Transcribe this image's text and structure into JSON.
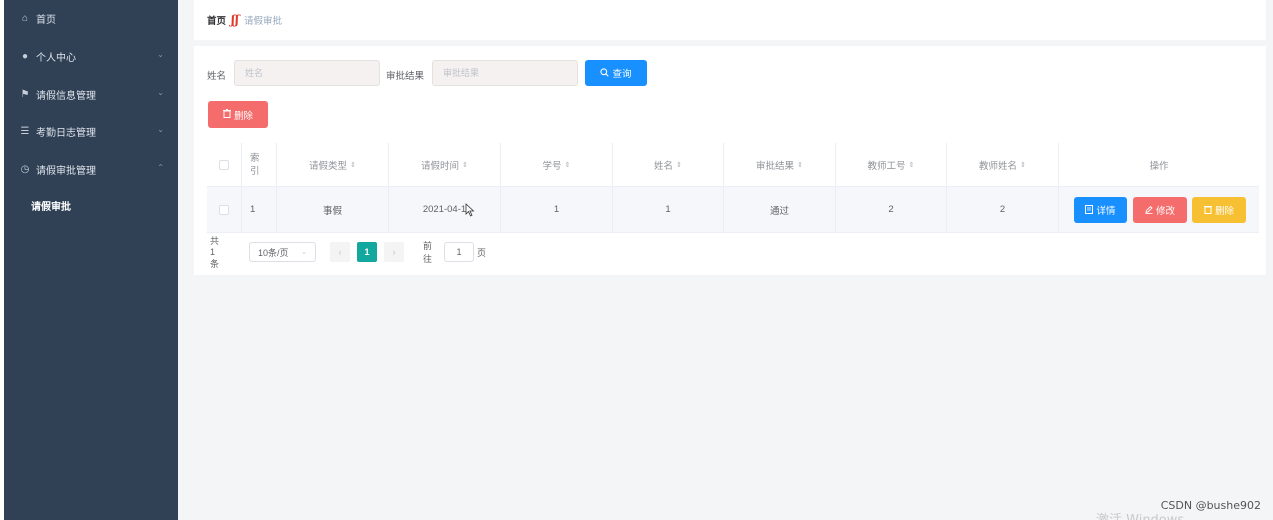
{
  "sidebar": {
    "items": [
      {
        "label": "首页",
        "icon": "home-icon",
        "glyph": "⌂"
      },
      {
        "label": "个人中心",
        "icon": "user-icon",
        "glyph": "●"
      },
      {
        "label": "请假信息管理",
        "icon": "flag-icon",
        "glyph": "⚑"
      },
      {
        "label": "考勤日志管理",
        "icon": "list-icon",
        "glyph": "☰"
      },
      {
        "label": "请假审批管理",
        "icon": "clock-icon",
        "glyph": "◷"
      }
    ],
    "submenu": {
      "label": "请假审批"
    },
    "chevron_down": "⌄",
    "chevron_up": "⌃",
    "bg_color": "#304156"
  },
  "breadcrumb": {
    "home": "首页",
    "separator": "ʃʃ",
    "current": "请假审批"
  },
  "search": {
    "name_label": "姓名",
    "name_placeholder": "姓名",
    "result_label": "审批结果",
    "result_placeholder": "审批结果",
    "query_label": "查询",
    "query_icon": "search-icon"
  },
  "toolbar": {
    "delete_label": "删除",
    "delete_icon": "trash-icon"
  },
  "table": {
    "headers": {
      "index": "索引",
      "leave_type": "请假类型",
      "leave_time": "请假时间",
      "student_no": "学号",
      "name": "姓名",
      "result": "审批结果",
      "teacher_no": "教师工号",
      "teacher_name": "教师姓名",
      "actions": "操作"
    },
    "sort_glyph": "⇕",
    "rows": [
      {
        "index": "1",
        "leave_type": "事假",
        "leave_time": "2021-04-1",
        "student_no": "1",
        "name": "1",
        "result": "通过",
        "teacher_no": "2",
        "teacher_name": "2"
      }
    ],
    "actions": {
      "detail": "详情",
      "edit": "修改",
      "delete": "删除"
    }
  },
  "pagination": {
    "total": "共 1 条",
    "page_size": "10条/页",
    "prev": "‹",
    "current_page": "1",
    "next": "›",
    "goto_label": "前往",
    "goto_value": "1",
    "page_unit": "页"
  },
  "watermarks": {
    "csdn": "CSDN @bushe902",
    "windows": "激活 Windows"
  },
  "colors": {
    "primary": "#1890ff",
    "danger": "#f56c6c",
    "warning": "#f7c033",
    "pager_active": "#13a89e"
  }
}
